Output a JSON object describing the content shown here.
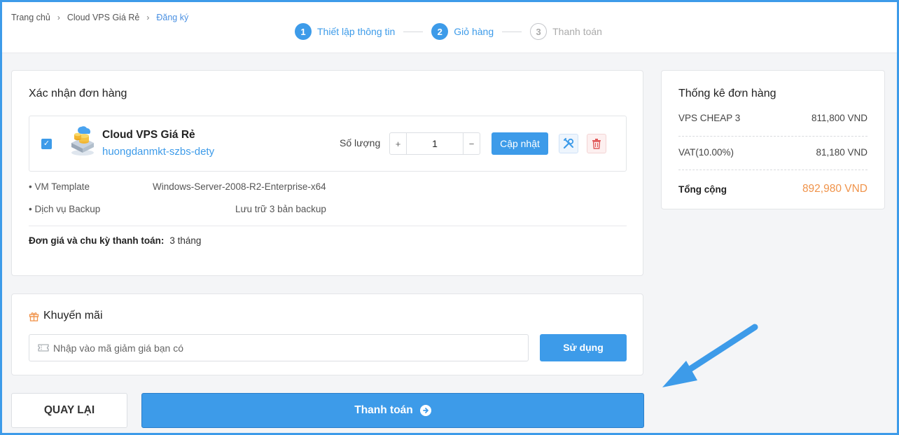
{
  "breadcrumb": {
    "items": [
      "Trang chủ",
      "Cloud VPS Giá Rẻ"
    ],
    "current": "Đăng ký"
  },
  "steps": [
    {
      "num": "1",
      "label": "Thiết lập thông tin",
      "state": "done"
    },
    {
      "num": "2",
      "label": "Giỏ hàng",
      "state": "active"
    },
    {
      "num": "3",
      "label": "Thanh toán",
      "state": "inactive"
    }
  ],
  "order": {
    "title": "Xác nhận đơn hàng",
    "product_name": "Cloud VPS Giá Rẻ",
    "hostname": "huongdanmkt-szbs-dety",
    "quantity_label": "Số lượng",
    "quantity": "1",
    "plus": "+",
    "minus": "−",
    "update_label": "Cập nhật",
    "specs": [
      {
        "label": "• VM Template",
        "value": "Windows-Server-2008-R2-Enterprise-x64"
      },
      {
        "label": "• Dịch vụ Backup",
        "value": "Lưu trữ 3 bản backup"
      }
    ],
    "cycle_label": "Đơn giá và chu kỳ thanh toán:",
    "cycle_value": "3 tháng"
  },
  "promo": {
    "title": "Khuyến mãi",
    "placeholder": "Nhập vào mã giảm giá bạn có",
    "use_label": "Sử dụng"
  },
  "actions": {
    "back_label": "QUAY LẠI",
    "pay_label": "Thanh toán"
  },
  "summary": {
    "title": "Thống kê đơn hàng",
    "rows": [
      {
        "label": "VPS CHEAP 3",
        "value": "811,800 VND"
      },
      {
        "label": "VAT(10.00%)",
        "value": "81,180 VND"
      }
    ],
    "total_label": "Tổng cộng",
    "total_value": "892,980 VND"
  },
  "colors": {
    "accent": "#3d9be9",
    "total": "#f0934a",
    "delete": "#e05a5a"
  }
}
